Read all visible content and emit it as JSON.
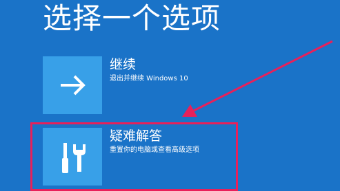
{
  "page": {
    "title": "选择一个选项"
  },
  "options": [
    {
      "title": "继续",
      "description": "退出并继续 Windows 10",
      "icon": "arrow-right-icon"
    },
    {
      "title": "疑难解答",
      "description": "重置你的电脑或查看高级选项",
      "icon": "tools-icon"
    }
  ],
  "colors": {
    "background": "#1a73c8",
    "tile": "#38a0e8",
    "annotation": "#e8205a"
  }
}
